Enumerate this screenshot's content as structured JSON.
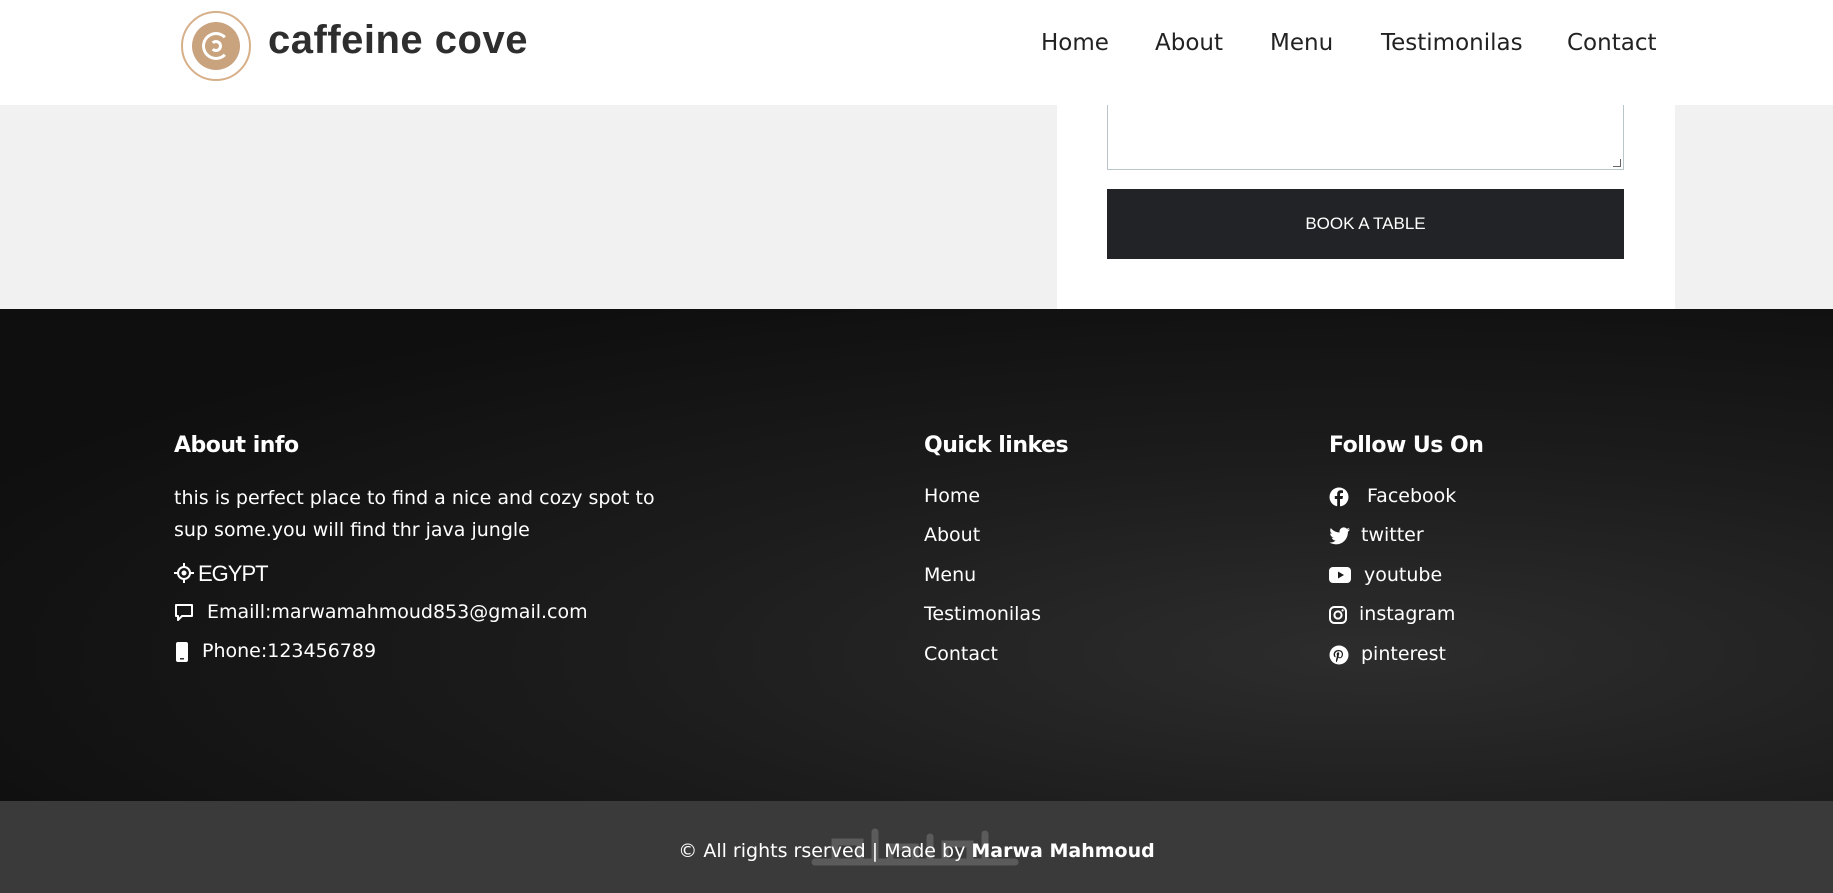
{
  "header": {
    "brand": "caffeine cove",
    "nav": [
      "Home",
      "About",
      "Menu",
      "Testimonilas",
      "Contact"
    ]
  },
  "booking": {
    "button_label": "BOOK A TABLE"
  },
  "footer": {
    "about": {
      "title": "About info",
      "description_line1": "this is perfect place to find a nice and cozy spot to",
      "description_line2": "sup some.you will find thr java jungle",
      "location": "EGYPT",
      "email": "Emaill:marwamahmoud853@gmail.com",
      "phone": "Phone:123456789"
    },
    "quick_links": {
      "title": "Quick linkes",
      "items": [
        "Home",
        "About",
        "Menu",
        "Testimonilas",
        "Contact"
      ]
    },
    "follow": {
      "title": "Follow Us On",
      "items": [
        {
          "label": "Facebook",
          "icon": "facebook-icon"
        },
        {
          "label": "twitter",
          "icon": "twitter-icon"
        },
        {
          "label": "youtube",
          "icon": "youtube-icon"
        },
        {
          "label": "instagram",
          "icon": "instagram-icon"
        },
        {
          "label": "pinterest",
          "icon": "pinterest-icon"
        }
      ]
    },
    "copyright_prefix": "© All rights rserved | Made by ",
    "copyright_author": "Marwa Mahmoud"
  },
  "colors": {
    "header_bg": "#ffffff",
    "page_bg": "#f0f1f0",
    "button_bg": "#212327",
    "footer_bg": "#141414",
    "bottom_bar_bg": "#3a3a3a",
    "logo_accent": "#c9a27e"
  }
}
